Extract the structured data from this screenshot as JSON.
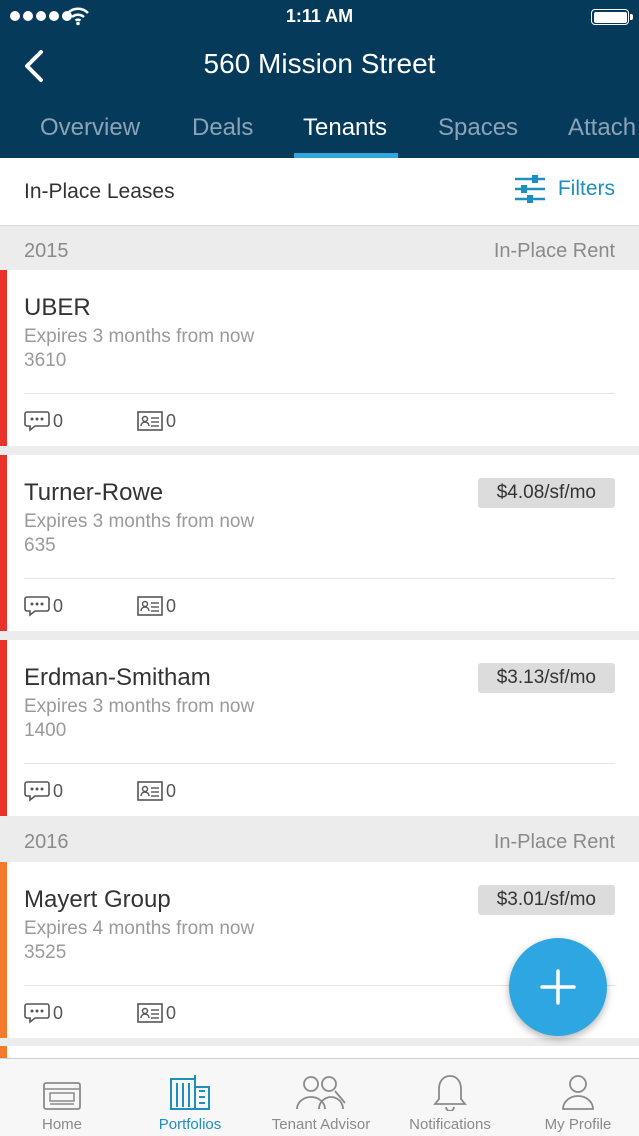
{
  "status_bar": {
    "time": "1:11 AM"
  },
  "nav": {
    "title": "560 Mission Street"
  },
  "tabs": [
    {
      "label": "Overview"
    },
    {
      "label": "Deals"
    },
    {
      "label": "Tenants"
    },
    {
      "label": "Spaces"
    },
    {
      "label": "Attach"
    }
  ],
  "active_tab": "Tenants",
  "subheader": {
    "title": "In-Place Leases",
    "filters_label": "Filters"
  },
  "sections": [
    {
      "year": "2015",
      "rent_label": "In-Place Rent",
      "leases": [
        {
          "name": "UBER",
          "expires": "Expires 3 months from now",
          "sqft": "3610",
          "rent": "",
          "comments": "0",
          "contacts": "0",
          "color": "#e8322c"
        },
        {
          "name": "Turner-Rowe",
          "expires": "Expires 3 months from now",
          "sqft": "635",
          "rent": "$4.08/sf/mo",
          "comments": "0",
          "contacts": "0",
          "color": "#e8322c"
        },
        {
          "name": "Erdman-Smitham",
          "expires": "Expires 3 months from now",
          "sqft": "1400",
          "rent": "$3.13/sf/mo",
          "comments": "0",
          "contacts": "0",
          "color": "#e8322c"
        }
      ]
    },
    {
      "year": "2016",
      "rent_label": "In-Place Rent",
      "leases": [
        {
          "name": "Mayert Group",
          "expires": "Expires 4 months from now",
          "sqft": "3525",
          "rent": "$3.01/sf/mo",
          "comments": "0",
          "contacts": "0",
          "color": "#f37b2b"
        }
      ]
    }
  ],
  "tabbar": [
    {
      "label": "Home",
      "icon": "home-icon"
    },
    {
      "label": "Portfolios",
      "icon": "building-icon"
    },
    {
      "label": "Tenant Advisor",
      "icon": "people-icon"
    },
    {
      "label": "Notifications",
      "icon": "bell-icon"
    },
    {
      "label": "My Profile",
      "icon": "profile-icon"
    }
  ],
  "active_tabbar": "Portfolios",
  "colors": {
    "header": "#063a5a",
    "accent": "#2ea6e2",
    "link": "#1d8fbf",
    "expiring_2015": "#e8322c",
    "expiring_2016": "#f37b2b"
  }
}
